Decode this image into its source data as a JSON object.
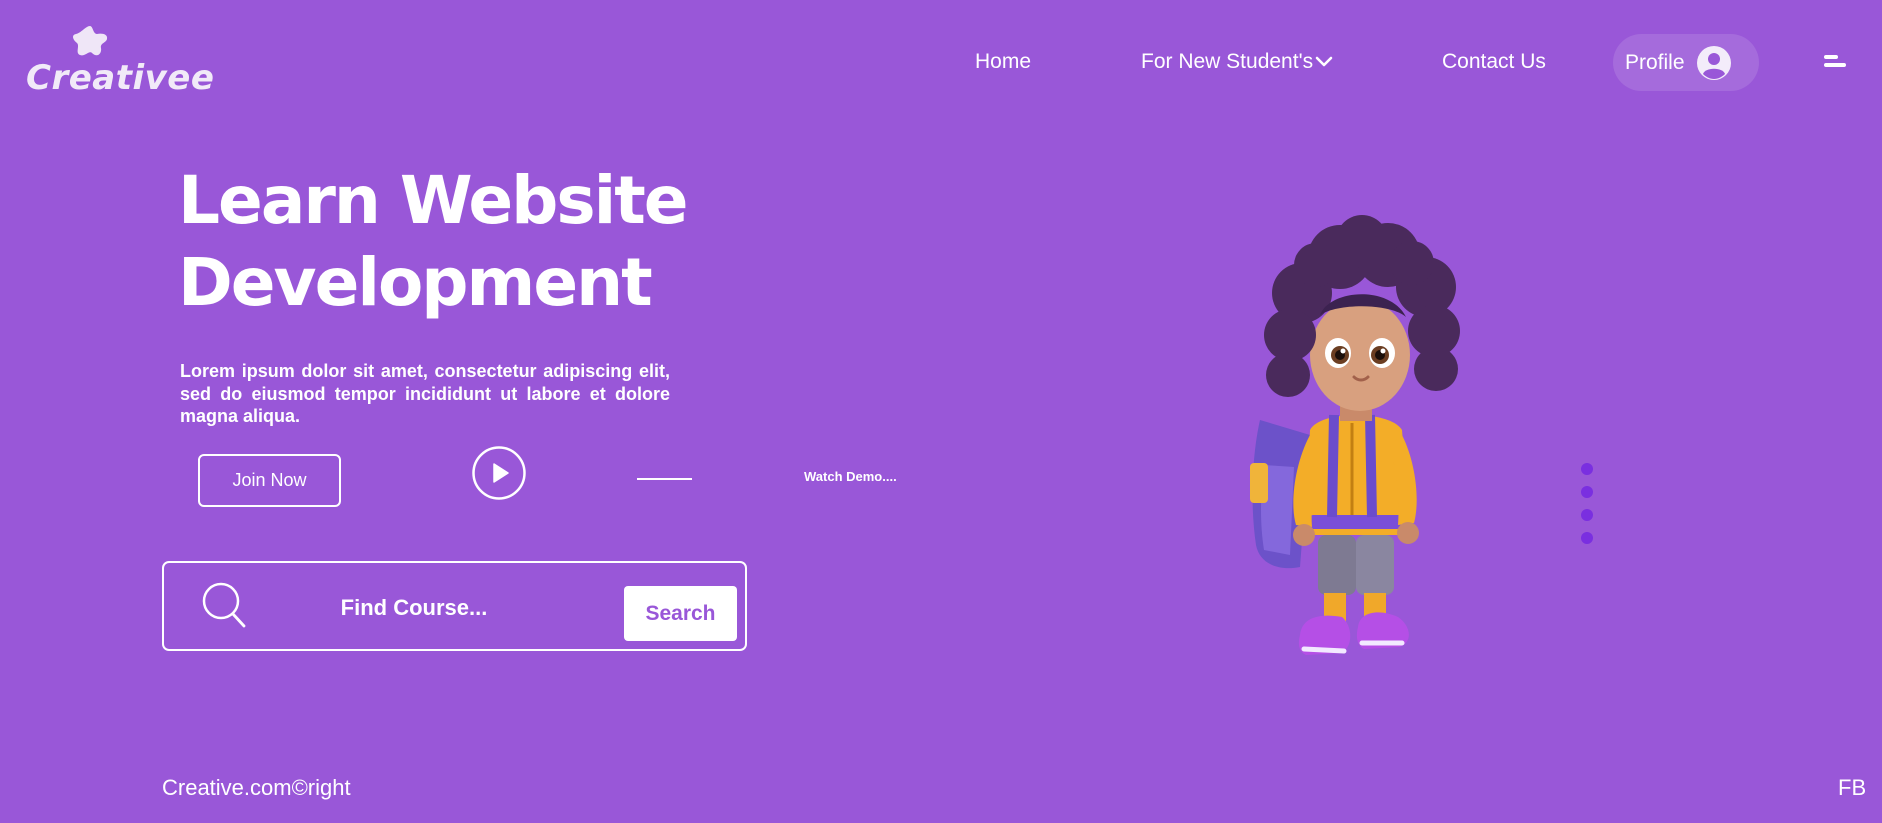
{
  "brand": {
    "name": "Creativee"
  },
  "nav": {
    "items": [
      {
        "label": "Home"
      },
      {
        "label": "For New Student's"
      },
      {
        "label": "Contact Us"
      }
    ],
    "profile_label": "Profile"
  },
  "hero": {
    "title_line1": "Learn Website",
    "title_line2": "Development",
    "description": "Lorem ipsum dolor sit amet, consectetur adipiscing elit, sed do eiusmod tempor incididunt ut labore et dolore magna aliqua.",
    "join_label": "Join Now",
    "demo_label": "Watch Demo...."
  },
  "search": {
    "placeholder": "Find Course...",
    "button_label": "Search"
  },
  "footer": {
    "copyright": "Creative.com©right",
    "social": "FB"
  },
  "icons": {
    "logo": "star-blob-icon",
    "dropdown": "chevron-down-icon",
    "profile": "user-avatar-icon",
    "menu": "menu-lines-icon",
    "play": "play-icon",
    "search": "search-icon",
    "carousel": "carousel-dots-icon"
  },
  "colors": {
    "background": "#9957d8",
    "text": "#ffffff",
    "accent_dots": "#7a2fe0"
  }
}
